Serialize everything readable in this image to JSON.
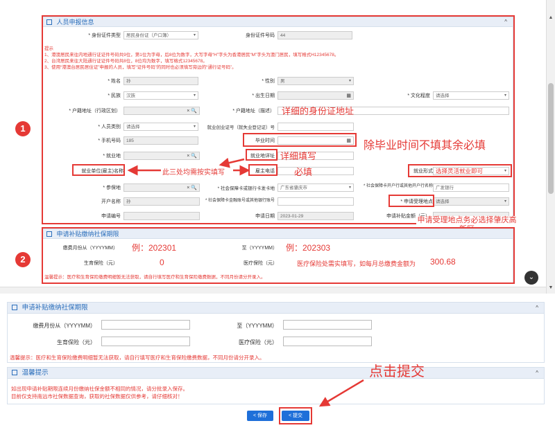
{
  "section1": {
    "title": "人员申报信息",
    "collapse": "^",
    "fields": {
      "id_type_label": "* 身份证件类型",
      "id_type_value": "居民身份证（户口簿）",
      "id_no_label": "身份证件号码",
      "id_no_value": "44",
      "name_label": "* 姓名",
      "name_value": "孙",
      "gender_label": "* 性别",
      "gender_value": "男",
      "ethnic_label": "* 民族",
      "ethnic_value": "汉族",
      "birth_label": "* 出生日期",
      "edu_label": "* 文化程度",
      "edu_value": "请选择",
      "hukou_label": "* 户籍地址（行政区划）",
      "hukou_desc_label": "* 户籍地址（描述）",
      "category_label": "* 人员类别",
      "category_value": "请选择",
      "cert_label": "就业创业证号（就失业登记证）号",
      "phone_label": "* 手机号码",
      "phone_value": "185",
      "grad_label": "毕业时间",
      "emp_label": "* 就业地",
      "emp_detail_label": "就业地详址",
      "employer_label": "就业单位(雇主)名称",
      "employer_phone_label": "雇主电话",
      "emp_form_label": "就业形式",
      "emp_form_value": "选择灵活就业即可",
      "insured_label": "* 参保地",
      "card_bank_label": "* 社会保障卡或银行卡发卡地",
      "card_bank_value": "广东省肇庆市",
      "bank_label": "* 社会保障卡开户行或其他开户行名称",
      "bank_value": "广发银行",
      "holder_label": "开户名称",
      "holder_value": "孙",
      "account_label": "* 社会保障卡金融账号或其他银行账号",
      "office_label": "* 申请受理地点",
      "office_value": "请选择",
      "app_no_label": "申请编号",
      "app_date_label": "申请日期",
      "app_date_value": "2023-01-29",
      "subsidy_label": "申请补贴金额（元）"
    },
    "tips_title": "提示",
    "tips": [
      "1、港澳居民来往内地通行证证件号码共9位，第1位为字母，后8位为数字，大写字母“H”字头为香港居民“M”字头为澳门居民，填写格式H12345678。",
      "2、台湾居民来往大陆通行证证件号码共8位，8位均为数字，填写格式12345678。",
      "3、使用“港澳台居民居住证”申报的人员，填写“证件号码”的同时也必须填写旁边的“通行证号码”。"
    ]
  },
  "section2": {
    "title": "申请补贴缴纳社保期限",
    "from_label": "缴费月份从（YYYYMM）",
    "to_label": "至（YYYYMM）",
    "birth_ins_label": "生育保险（元）",
    "med_ins_label": "医疗保险（元）",
    "tip": "温馨提示：医疗和生育保险缴费明细暂无法获取，请自行填写医疗和生育保险缴费数据，不同月份请分开录入。"
  },
  "lower": {
    "period_title": "申请补贴缴纳社保期限",
    "from_label": "缴费月份从（YYYYMM）",
    "to_label": "至（YYYYMM）",
    "birth_ins_label": "生育保险（元）",
    "med_ins_label": "医疗保险（元）",
    "tip": "温馨提示：医疗和生育保险缴费明细暂无法获取，请自行填写医疗和生育保险缴费数据，不同月份请分开录入。",
    "warm_title": "温馨提示",
    "warm_lines": [
      "如出现申请补贴期限连续月份缴纳社保金额不相同的情况，请分批录入保存。",
      "目前仅支持南远市社保数据查询，获取的社保数据仅供参考，请仔细核对！"
    ],
    "save_btn": "< 保存",
    "submit_btn": "< 提交",
    "collapse": "^"
  },
  "annotations": {
    "num1": "1",
    "num2": "2",
    "hukou_desc": "详细的身份证地址",
    "except_grad": "除毕业时间不填其余必填",
    "detail_fill": "详细填写",
    "required": "必填",
    "three_same": "此三处均需按实填写",
    "office_note": "申请受理地点务必选择肇庆高新区",
    "from_example": "例：202301",
    "to_example": "例：202303",
    "birth_zero": "0",
    "med_note": "医疗保险处需实填写，如每月总缴费金额为",
    "med_amount": "300.68",
    "click_submit": "点击提交"
  },
  "colors": {
    "red": "#e53935",
    "blue": "#1e6fd9",
    "panel_header": "#e8eef7"
  }
}
